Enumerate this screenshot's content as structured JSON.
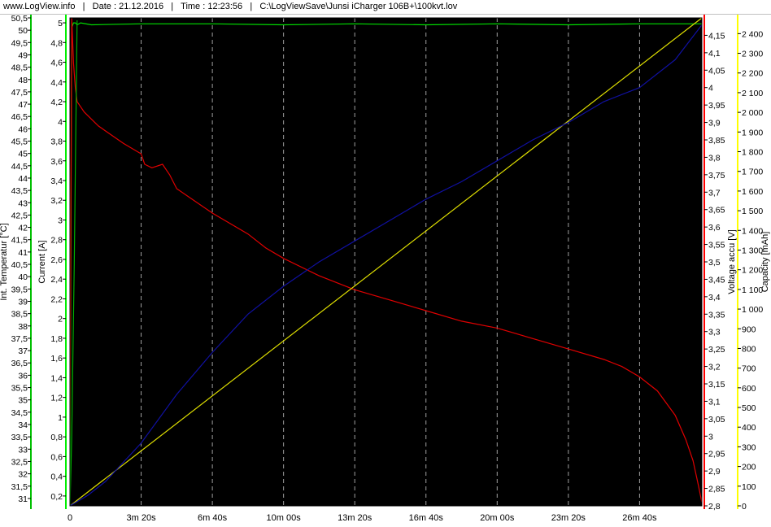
{
  "header": {
    "site": "www.LogView.info",
    "date": "Date : 21.12.2016",
    "time": "Time : 12:23:56",
    "file": "C:\\LogViewSave\\Junsi iCharger 106B+\\100kvt.lov"
  },
  "colors": {
    "background": "#000000",
    "grid": "#a0a0a0",
    "temperature": "#00b000",
    "current": "#00dd00",
    "voltage": "#e00000",
    "capacity": "#dddd00",
    "blue_series": "#1010a0",
    "temp_axis_line": "#00c000",
    "current_axis_line": "#00ee00",
    "voltage_axis_line": "#ff0000",
    "capacity_axis_line": "#ffff00"
  },
  "chart_data": {
    "type": "line",
    "x_unit": "seconds",
    "x_range": [
      0,
      1775
    ],
    "xticks": [
      {
        "value": 0,
        "label": "0"
      },
      {
        "value": 200,
        "label": "3m 20s"
      },
      {
        "value": 400,
        "label": "6m 40s"
      },
      {
        "value": 600,
        "label": "10m 00s"
      },
      {
        "value": 800,
        "label": "13m 20s"
      },
      {
        "value": 1000,
        "label": "16m 40s"
      },
      {
        "value": 1200,
        "label": "20m 00s"
      },
      {
        "value": 1400,
        "label": "23m 20s"
      },
      {
        "value": 1600,
        "label": "26m 40s"
      }
    ],
    "grid": "vertical dashed",
    "axes": [
      {
        "id": "temp",
        "label": "Int. Temperatur [°C]",
        "side": "left",
        "range": [
          30.7,
          50.5
        ],
        "ticks": [
          "31",
          "31,5",
          "32",
          "32,5",
          "33",
          "33,5",
          "34",
          "34,5",
          "35",
          "35,5",
          "36",
          "36,5",
          "37",
          "37,5",
          "38",
          "38,5",
          "39",
          "39,5",
          "40",
          "40,5",
          "41",
          "41,5",
          "42",
          "42,5",
          "43",
          "43,5",
          "44",
          "44,5",
          "45",
          "45,5",
          "46",
          "46,5",
          "47",
          "47,5",
          "48",
          "48,5",
          "49",
          "49,5",
          "50",
          "50,5"
        ]
      },
      {
        "id": "current",
        "label": "Current [A]",
        "side": "left",
        "range": [
          0.1,
          5.05
        ],
        "ticks": [
          "0,2",
          "0,4",
          "0,6",
          "0,8",
          "1",
          "1,2",
          "1,4",
          "1,6",
          "1,8",
          "2",
          "2,2",
          "2,4",
          "2,6",
          "2,8",
          "3",
          "3,2",
          "3,4",
          "3,6",
          "3,8",
          "4",
          "4,2",
          "4,4",
          "4,6",
          "4,8",
          "5"
        ]
      },
      {
        "id": "voltage",
        "label": "Voltage accu [V]",
        "side": "right",
        "range": [
          2.8,
          4.2
        ],
        "ticks": [
          "2,8",
          "2,85",
          "2,9",
          "2,95",
          "3",
          "3,05",
          "3,1",
          "3,15",
          "3,2",
          "3,25",
          "3,3",
          "3,35",
          "3,4",
          "3,45",
          "3,5",
          "3,55",
          "3,6",
          "3,65",
          "3,7",
          "3,75",
          "3,8",
          "3,85",
          "3,9",
          "3,95",
          "4",
          "4,05",
          "4,1",
          "4,15"
        ]
      },
      {
        "id": "capacity",
        "label": "Capacity [mAh]",
        "side": "right",
        "range": [
          0,
          2480
        ],
        "ticks": [
          "0",
          "100",
          "200",
          "300",
          "400",
          "500",
          "600",
          "700",
          "800",
          "900",
          "1 000",
          "1 100",
          "1 200",
          "1 300",
          "1 400",
          "1 500",
          "1 600",
          "1 700",
          "1 800",
          "1 900",
          "2 000",
          "2 100",
          "2 200",
          "2 300",
          "2 400"
        ]
      }
    ],
    "series": [
      {
        "axis": "current",
        "color_key": "current",
        "x": [
          0,
          5,
          10,
          15,
          20,
          30,
          60,
          200,
          400,
          600,
          800,
          1000,
          1200,
          1400,
          1600,
          1775
        ],
        "y": [
          0.15,
          4.95,
          5.0,
          5.0,
          4.98,
          5.0,
          4.98,
          4.99,
          4.99,
          4.98,
          4.99,
          4.98,
          4.99,
          4.98,
          4.99,
          4.99
        ]
      },
      {
        "axis": "voltage",
        "color_key": "voltage",
        "x": [
          0,
          5,
          10,
          15,
          20,
          40,
          80,
          150,
          200,
          210,
          230,
          260,
          280,
          300,
          400,
          500,
          550,
          600,
          700,
          800,
          900,
          1000,
          1100,
          1200,
          1300,
          1400,
          1500,
          1550,
          1600,
          1650,
          1700,
          1730,
          1750,
          1765,
          1775
        ],
        "y": [
          3.0,
          4.2,
          4.07,
          4.0,
          3.96,
          3.93,
          3.89,
          3.84,
          3.81,
          3.78,
          3.77,
          3.78,
          3.75,
          3.71,
          3.64,
          3.58,
          3.54,
          3.51,
          3.46,
          3.42,
          3.39,
          3.36,
          3.33,
          3.31,
          3.28,
          3.25,
          3.22,
          3.2,
          3.17,
          3.13,
          3.06,
          2.99,
          2.93,
          2.86,
          2.81
        ]
      },
      {
        "axis": "capacity",
        "color_key": "capacity",
        "x": [
          0,
          1775
        ],
        "y": [
          0,
          2480
        ]
      },
      {
        "axis": "voltage",
        "color_key": "blue_series",
        "x": [
          0,
          50,
          100,
          200,
          300,
          400,
          500,
          600,
          700,
          800,
          900,
          1000,
          1100,
          1200,
          1300,
          1400,
          1500,
          1600,
          1700,
          1775
        ],
        "y": [
          2.8,
          2.83,
          2.87,
          2.98,
          3.12,
          3.24,
          3.35,
          3.43,
          3.5,
          3.56,
          3.62,
          3.68,
          3.73,
          3.79,
          3.85,
          3.9,
          3.96,
          4.0,
          4.08,
          4.18
        ]
      },
      {
        "axis": "temp",
        "color_key": "temperature",
        "x": [
          0,
          5,
          12,
          20
        ],
        "y": [
          30.7,
          33.5,
          40.5,
          50.4
        ]
      }
    ]
  }
}
